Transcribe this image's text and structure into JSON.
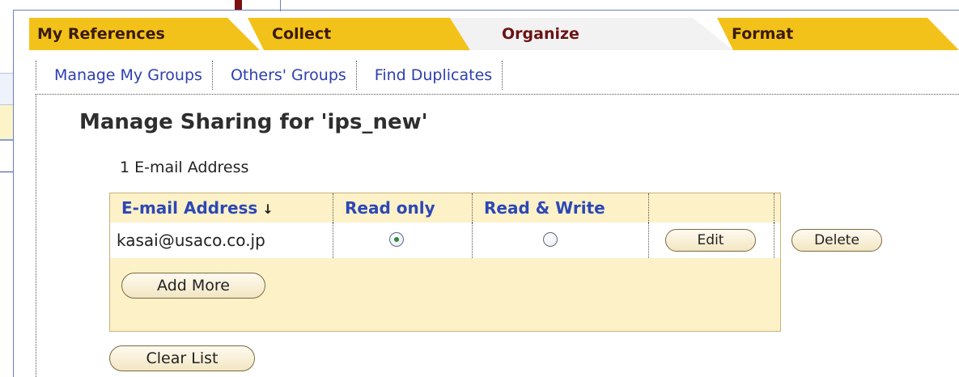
{
  "tabs": [
    {
      "label": "My References",
      "active": false
    },
    {
      "label": "Collect",
      "active": false
    },
    {
      "label": "Organize",
      "active": true
    },
    {
      "label": "Format",
      "active": false
    }
  ],
  "subnav": [
    {
      "label": "Manage My Groups"
    },
    {
      "label": "Others' Groups"
    },
    {
      "label": "Find Duplicates"
    }
  ],
  "page": {
    "title": "Manage Sharing for 'ips_new'",
    "count_text": "1 E-mail Address"
  },
  "table": {
    "headers": {
      "email": "E-mail Address",
      "read_only": "Read only",
      "read_write": "Read & Write"
    },
    "sort_icon": "↓",
    "rows": [
      {
        "email": "kasai@usaco.co.jp",
        "permission": "read_only",
        "edit_label": "Edit",
        "delete_label": "Delete"
      }
    ],
    "add_more_label": "Add More"
  },
  "clear_list_label": "Clear List",
  "colors": {
    "tab_gold": "#f3c21a",
    "tab_active_bg": "#f2f2f2",
    "link_blue": "#2c3fae",
    "header_blue": "#2c48b6",
    "table_bg": "#fdf1c8",
    "active_tab_text": "#6b1212"
  }
}
